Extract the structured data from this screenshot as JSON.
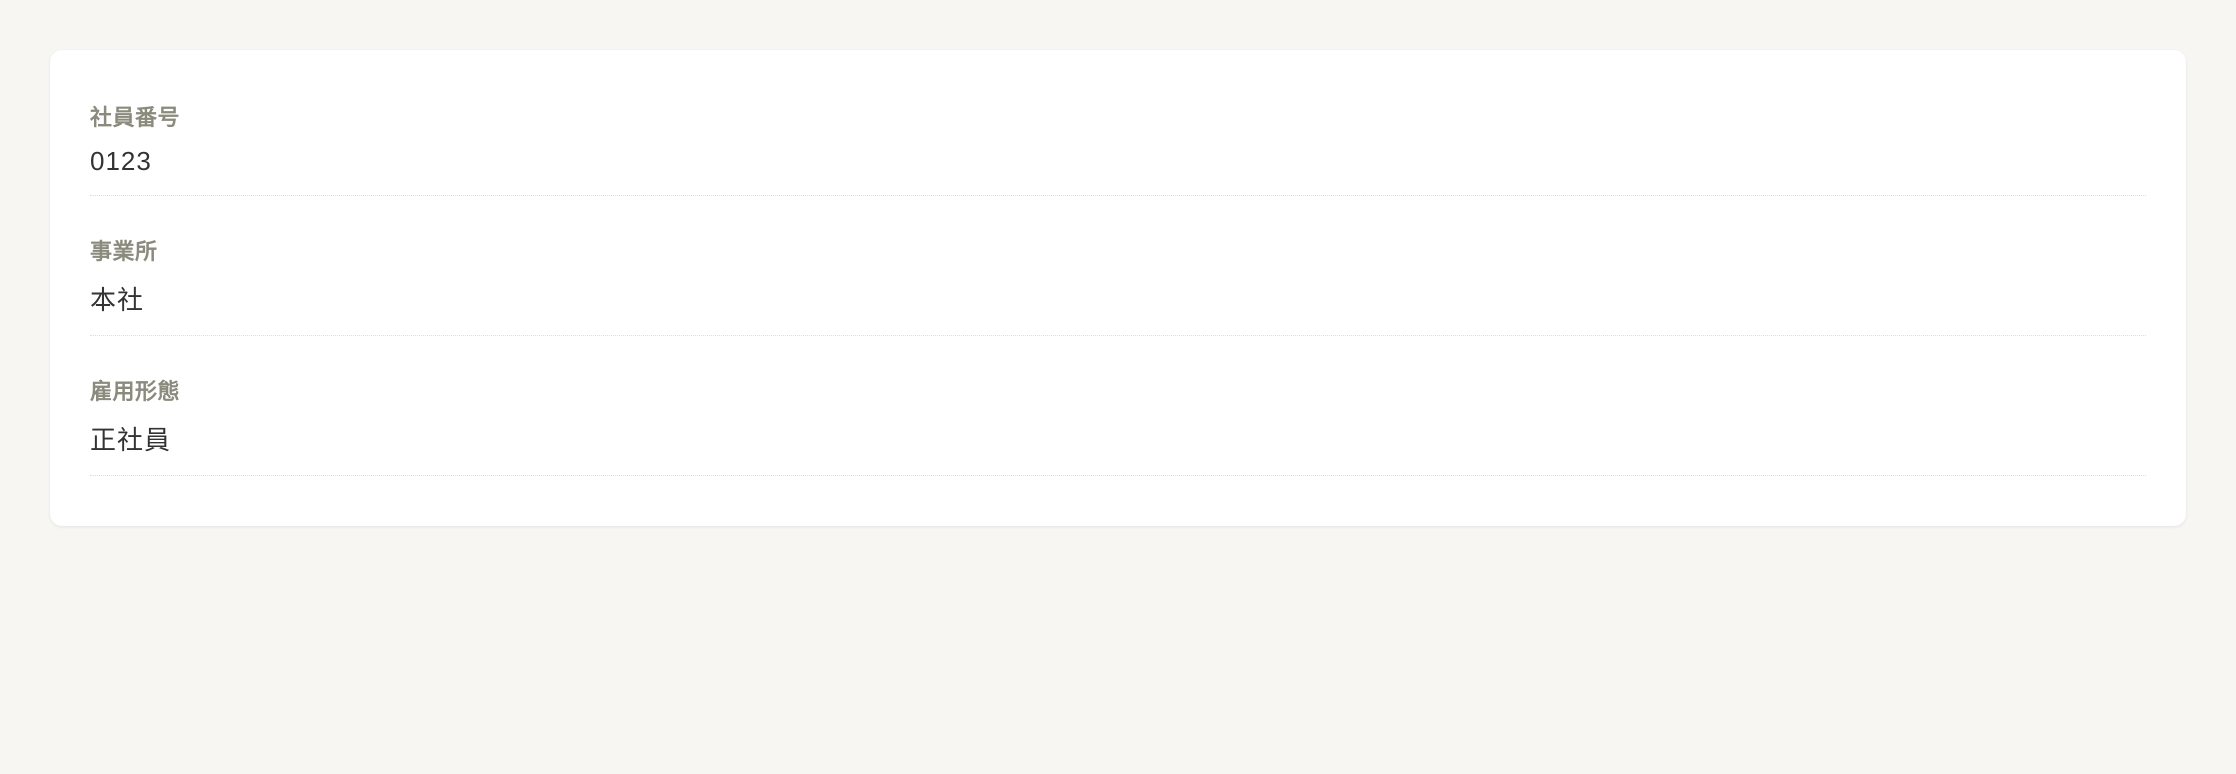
{
  "fields": [
    {
      "label": "社員番号",
      "value": "0123"
    },
    {
      "label": "事業所",
      "value": "本社"
    },
    {
      "label": "雇用形態",
      "value": "正社員"
    }
  ]
}
